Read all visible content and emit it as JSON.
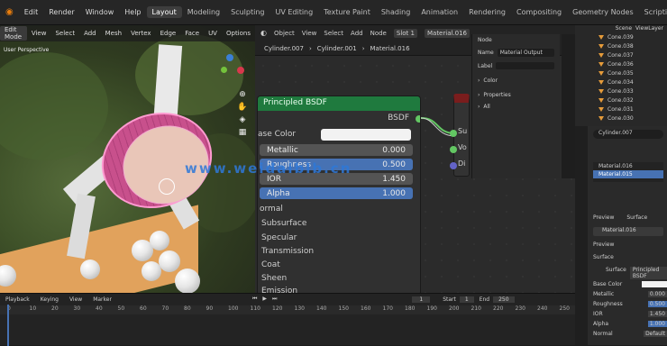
{
  "menubar": {
    "items": [
      "Edit",
      "Render",
      "Window",
      "Help"
    ],
    "workspaces": [
      "Layout",
      "Modeling",
      "Sculpting",
      "UV Editing",
      "Texture Paint",
      "Shading",
      "Animation",
      "Rendering",
      "Compositing",
      "Geometry Nodes",
      "Scripting"
    ],
    "active_workspace": "Layout",
    "scene_label": "Scene",
    "viewlayer_label": "ViewLayer"
  },
  "viewport": {
    "header_items": [
      "Edit Mode",
      "View",
      "Select",
      "Add",
      "Mesh",
      "Vertex",
      "Edge",
      "Face",
      "UV"
    ],
    "mode_label": "Edit Mode",
    "options_label": "Options",
    "overlay_label": "User Perspective"
  },
  "node_editor": {
    "header_items": [
      "Object",
      "View",
      "Select",
      "Add",
      "Node"
    ],
    "slot_label": "Slot 1",
    "material_label": "Material.016",
    "breadcrumb": [
      "Cylinder.007",
      "Cylinder.001",
      "Material.016"
    ],
    "node_title": "Principled BSDF",
    "output_label": "BSDF",
    "base_color_label": "ase Color",
    "inputs": [
      {
        "label": "Metallic",
        "value": "0.000",
        "highlight": false
      },
      {
        "label": "Roughness",
        "value": "0.500",
        "highlight": true
      },
      {
        "label": "IOR",
        "value": "1.450",
        "highlight": false
      },
      {
        "label": "Alpha",
        "value": "1.000",
        "highlight": true
      }
    ],
    "sections": [
      "ormal",
      "Subsurface",
      "Specular",
      "Transmission",
      "Coat",
      "Sheen",
      "Emission"
    ],
    "out_sockets": [
      "Su",
      "Vo",
      "Di"
    ],
    "side_panel": {
      "tab_label": "Node",
      "name_label": "Name",
      "name_value": "Material Output",
      "label_label": "Label",
      "color_label": "Color",
      "properties_label": "Properties",
      "target_label": "All"
    }
  },
  "outliner": {
    "items": [
      "Cone.039",
      "Cone.038",
      "Cone.037",
      "Cone.036",
      "Cone.035",
      "Cone.034",
      "Cone.033",
      "Cone.032",
      "Cone.031",
      "Cone.030"
    ]
  },
  "properties": {
    "search_placeholder": "Cylinder.007",
    "materials": [
      "Material.016",
      "Material.015"
    ],
    "tabs": [
      "Preview",
      "Surface"
    ],
    "material_name": "Material.016",
    "section_preview": "Preview",
    "section_surface": "Surface",
    "surface_label": "Surface",
    "surface_value": "Principled BSDF",
    "rows": [
      {
        "label": "Base Color",
        "value": ""
      },
      {
        "label": "Metallic",
        "value": "0.000"
      },
      {
        "label": "Roughness",
        "value": "0.500"
      },
      {
        "label": "IOR",
        "value": "1.450"
      },
      {
        "label": "Alpha",
        "value": "1.000"
      },
      {
        "label": "Normal",
        "value": "Default"
      }
    ]
  },
  "timeline": {
    "header_items": [
      "Playback",
      "Keying",
      "View",
      "Marker"
    ],
    "current_frame": "1",
    "start_label": "Start",
    "start_value": "1",
    "end_label": "End",
    "end_value": "250",
    "ruler_ticks": [
      "0",
      "10",
      "20",
      "30",
      "40",
      "50",
      "60",
      "70",
      "80",
      "90",
      "100",
      "110",
      "120",
      "130",
      "140",
      "150",
      "160",
      "170",
      "180",
      "190",
      "200",
      "210",
      "220",
      "230",
      "240",
      "250"
    ]
  },
  "watermark": "www.weidaiblb.cn",
  "colors": {
    "node_header": "#1f7a3e",
    "field_highlight": "#4772b3",
    "socket_green": "#63c763",
    "socket_purple": "#6363c7",
    "socket_grey": "#a1a1a1"
  }
}
